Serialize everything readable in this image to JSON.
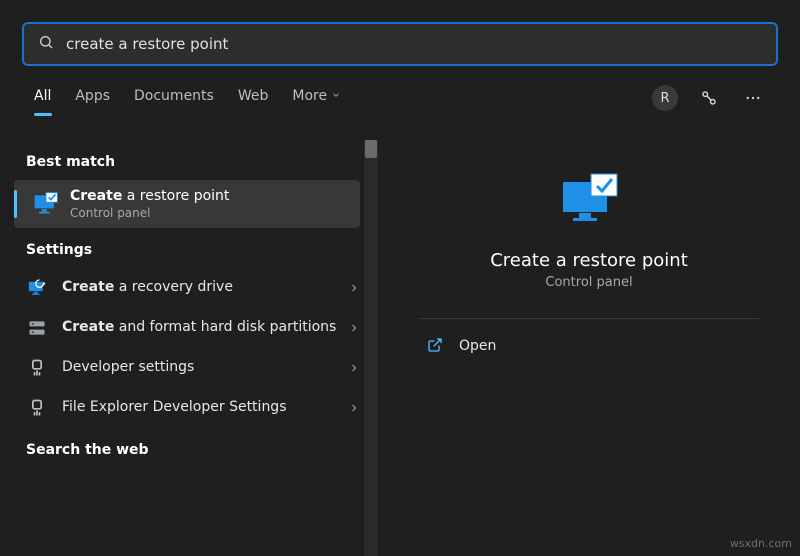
{
  "search": {
    "value": "create a restore point"
  },
  "tabs": {
    "all": "All",
    "apps": "Apps",
    "documents": "Documents",
    "web": "Web",
    "more": "More"
  },
  "user_initial": "R",
  "left": {
    "best_match_header": "Best match",
    "best": {
      "title_bold": "Create",
      "title_rest": " a restore point",
      "sub": "Control panel"
    },
    "settings_header": "Settings",
    "settings": [
      {
        "bold": "Create",
        "rest": " a recovery drive"
      },
      {
        "bold": "Create",
        "rest": " and format hard disk partitions"
      },
      {
        "bold": "",
        "rest": "Developer settings"
      },
      {
        "bold": "",
        "rest": "File Explorer Developer Settings"
      }
    ],
    "search_web_header": "Search the web"
  },
  "detail": {
    "title": "Create a restore point",
    "sub": "Control panel",
    "open": "Open"
  },
  "watermark": "wsxdn.com"
}
